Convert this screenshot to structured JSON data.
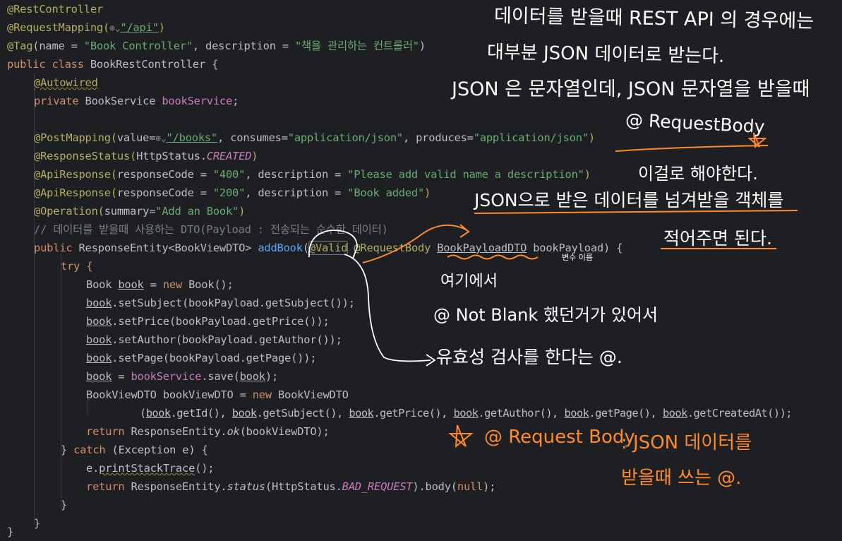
{
  "code": {
    "l1": "@RestController",
    "l2a": "@RequestMapping(",
    "l2b": "\"/api\"",
    "l2c": ")",
    "l3a": "@Tag",
    "l3b": "(name = ",
    "l3c": "\"Book Controller\"",
    "l3d": ", description = ",
    "l3e": "\"책을 관리하는 컨트롤러\"",
    "l3f": ")",
    "l4a": "public class ",
    "l4b": "BookRestController {",
    "l5": "@Autowired",
    "l6a": "private ",
    "l6b": "BookService ",
    "l6c": "bookService",
    "l6d": ";",
    "l8a": "@PostMapping(",
    "l8b": "value=",
    "l8c": "\"/books\"",
    "l8d": ", consumes=",
    "l8e": "\"application/json\"",
    "l8f": ", produces=",
    "l8g": "\"application/json\"",
    "l8h": ")",
    "l9a": "@ResponseStatus(",
    "l9b": "HttpStatus.",
    "l9c": "CREATED",
    "l9d": ")",
    "l10a": "@ApiResponse(",
    "l10b": "responseCode = ",
    "l10c": "\"400\"",
    "l10d": ", description = ",
    "l10e": "\"Please add valid name a description\"",
    "l10f": ")",
    "l11a": "@ApiResponse(",
    "l11b": "responseCode = ",
    "l11c": "\"200\"",
    "l11d": ", description = ",
    "l11e": "\"Book added\"",
    "l11f": ")",
    "l12a": "@Operation(",
    "l12b": "summary=",
    "l12c": "\"Add an Book\"",
    "l12d": ")",
    "l13": "// 데이터를 받을때 사용하는 DTO(Payload : 전송되는 순수한 데이터)",
    "l14a": "public ",
    "l14b": "ResponseEntity<BookViewDTO> ",
    "l14c": "addBook",
    "l14d": "(",
    "l14e": "@Valid",
    "l14f": " @RequestBody ",
    "l14g": "BookPayloadDTO",
    "l14h": " bookPayload) {",
    "l15": "try {",
    "l16a": "Book ",
    "l16b": "book",
    "l16c": " = ",
    "l16d": "new ",
    "l16e": "Book();",
    "l17a": "book",
    "l17b": ".setSubject(bookPayload.getSubject());",
    "l18a": "book",
    "l18b": ".setPrice(bookPayload.getPrice());",
    "l19a": "book",
    "l19b": ".setAuthor(bookPayload.getAuthor());",
    "l20a": "book",
    "l20b": ".setPage(bookPayload.getPage());",
    "l21a": "book",
    "l21b": " = ",
    "l21c": "bookService",
    "l21d": ".save(",
    "l21e": "book",
    "l21f": ");",
    "l22a": "BookViewDTO bookViewDTO = ",
    "l22b": "new ",
    "l22c": "BookViewDTO",
    "l23a": "(",
    "l23b": "book",
    "l23c": ".getId(), ",
    "l23d": "book",
    "l23e": ".getSubject(), ",
    "l23f": "book",
    "l23g": ".getPrice(), ",
    "l23h": "book",
    "l23i": ".getAuthor(), ",
    "l23j": "book",
    "l23k": ".getPage(), ",
    "l23l": "book",
    "l23m": ".getCreatedAt());",
    "l24a": "return ",
    "l24b": "ResponseEntity.",
    "l24c": "ok",
    "l24d": "(bookViewDTO);",
    "l25a": "} ",
    "l25b": "catch ",
    "l25c": "(Exception e) {",
    "l26a": "e.",
    "l26b": "printStackTrace",
    "l26c": "();",
    "l27a": "return ",
    "l27b": "ResponseEntity.",
    "l27c": "status",
    "l27d": "(HttpStatus.",
    "l27e": "BAD_REQUEST",
    "l27f": ").body(",
    "l27g": "null",
    "l27h": ");",
    "l28": "}",
    "l29": "}",
    "l30": "}"
  },
  "notes": {
    "n1": "데이터를 받을때 REST API 의 경우에는",
    "n2": "대부분 JSON 데이터로 받는다.",
    "n3": "JSON 은 문자열인데, JSON 문자열을 받을때",
    "n4": "@ RequestBody",
    "n5": "이걸로 해야한다.",
    "n6": "JSON으로 받은 데이터를 넘겨받을 객체를",
    "n7": "적어주면 된다.",
    "n8": "변수 이름",
    "n9": "여기에서",
    "n10": "@ Not Blank 했던거가 있어서",
    "n11": "유효성 검사를 한다는 @.",
    "n12": "@ Request Body",
    "n13": ": JSON 데이터를",
    "n14": "받을때 쓰는 @."
  },
  "colors": {
    "background": "#1e1f22",
    "annotation": "#b3ae60",
    "keyword": "#cf8e6d",
    "string": "#6aab73",
    "field": "#c77dbb",
    "method": "#56a8f5",
    "comment": "#7a7e85",
    "ink_white": "#ffffff",
    "ink_orange": "#ff8a2a"
  },
  "icons": [
    "globe-icon",
    "chevron-down-icon"
  ]
}
